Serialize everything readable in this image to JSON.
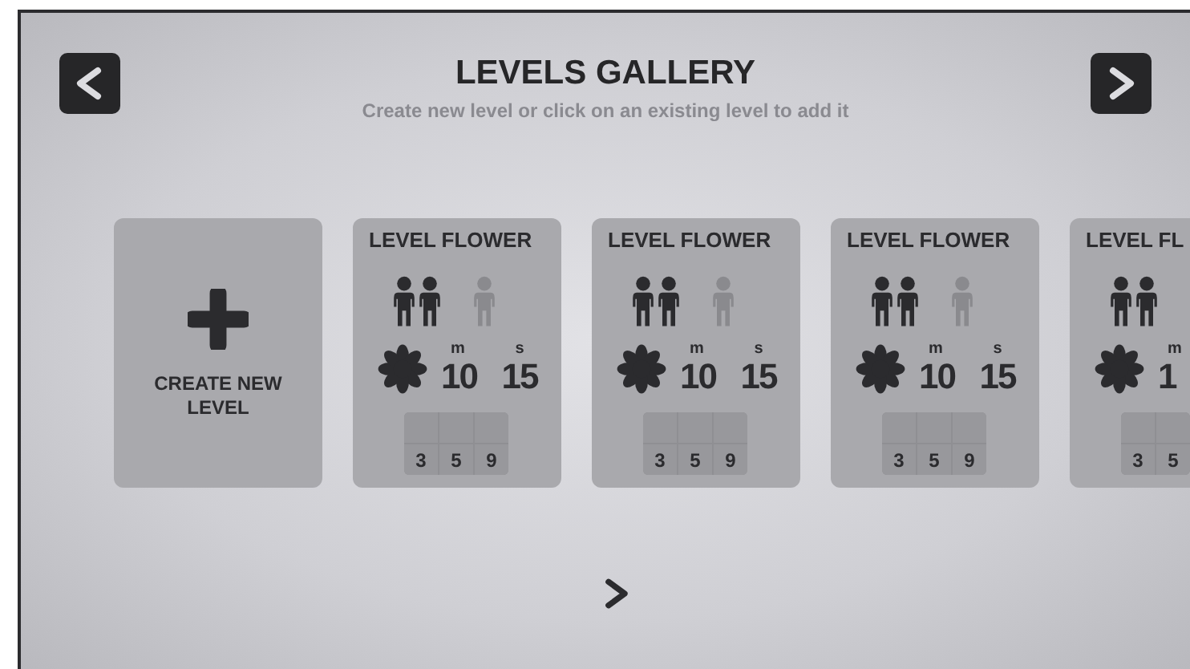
{
  "header": {
    "title": "LEVELS GALLERY",
    "subtitle": "Create new level or click on an existing level to add it"
  },
  "create_card": {
    "label": "CREATE NEW LEVEL"
  },
  "levels": [
    {
      "title": "LEVEL FLOWER",
      "figures": [
        {
          "active": true
        },
        {
          "active": true
        },
        {
          "active": false
        }
      ],
      "minutes": "10",
      "minutes_unit": "m",
      "seconds": "15",
      "seconds_unit": "s",
      "counts": [
        "3",
        "5",
        "9"
      ]
    },
    {
      "title": "LEVEL FLOWER",
      "figures": [
        {
          "active": true
        },
        {
          "active": true
        },
        {
          "active": false
        }
      ],
      "minutes": "10",
      "minutes_unit": "m",
      "seconds": "15",
      "seconds_unit": "s",
      "counts": [
        "3",
        "5",
        "9"
      ]
    },
    {
      "title": "LEVEL FLOWER",
      "figures": [
        {
          "active": true
        },
        {
          "active": true
        },
        {
          "active": false
        }
      ],
      "minutes": "10",
      "minutes_unit": "m",
      "seconds": "15",
      "seconds_unit": "s",
      "counts": [
        "3",
        "5",
        "9"
      ]
    },
    {
      "title": "LEVEL FL",
      "figures": [
        {
          "active": true
        },
        {
          "active": true
        }
      ],
      "minutes": "1",
      "minutes_unit": "m",
      "counts": [
        "3",
        "5"
      ]
    }
  ]
}
